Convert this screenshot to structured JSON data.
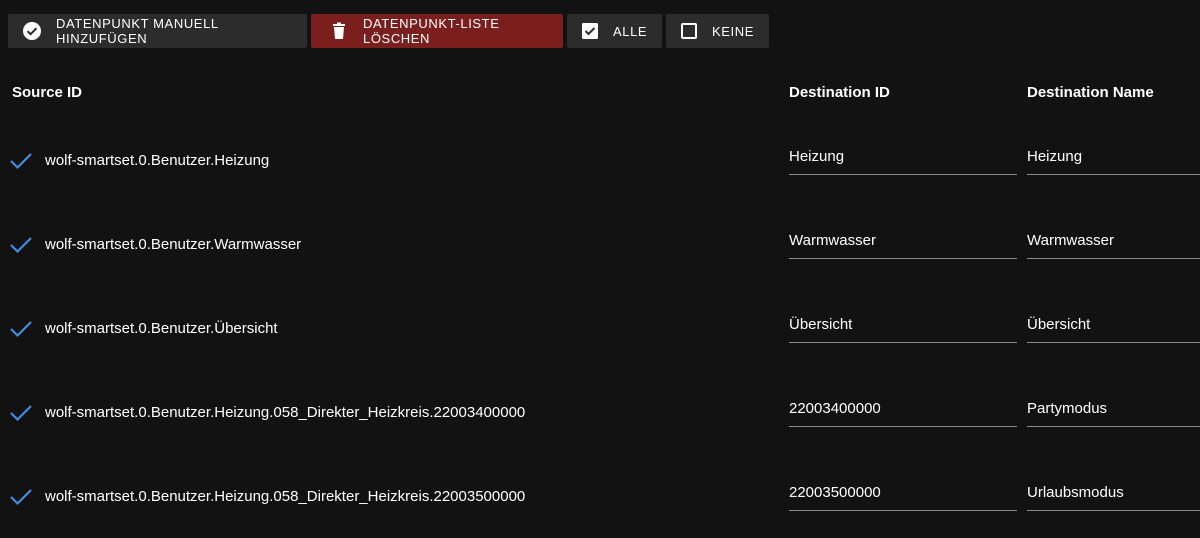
{
  "toolbar": {
    "add_label": "DATENPUNKT MANUELL HINZUFÜGEN",
    "delete_label": "DATENPUNKT-LISTE LÖSCHEN",
    "all_label": "ALLE",
    "none_label": "KEINE"
  },
  "table": {
    "headers": {
      "source": "Source ID",
      "destination": "Destination ID",
      "name": "Destination Name"
    },
    "rows": [
      {
        "source": "wolf-smartset.0.Benutzer.Heizung",
        "destination": "Heizung",
        "name": "Heizung"
      },
      {
        "source": "wolf-smartset.0.Benutzer.Warmwasser",
        "destination": "Warmwasser",
        "name": "Warmwasser"
      },
      {
        "source": "wolf-smartset.0.Benutzer.Übersicht",
        "destination": "Übersicht",
        "name": "Übersicht"
      },
      {
        "source": "wolf-smartset.0.Benutzer.Heizung.058_Direkter_Heizkreis.22003400000",
        "destination": "22003400000",
        "name": "Partymodus"
      },
      {
        "source": "wolf-smartset.0.Benutzer.Heizung.058_Direkter_Heizkreis.22003500000",
        "destination": "22003500000",
        "name": "Urlaubsmodus"
      }
    ]
  },
  "colors": {
    "background": "#121212",
    "button": "#2c2c2c",
    "danger_button": "#7a1e1e",
    "check_accent": "#3f8fe0"
  },
  "icons": {
    "add": "check-circle-icon",
    "delete": "trash-icon",
    "all": "checkbox-checked-icon",
    "none": "checkbox-empty-icon",
    "row_check": "checkmark-icon"
  }
}
